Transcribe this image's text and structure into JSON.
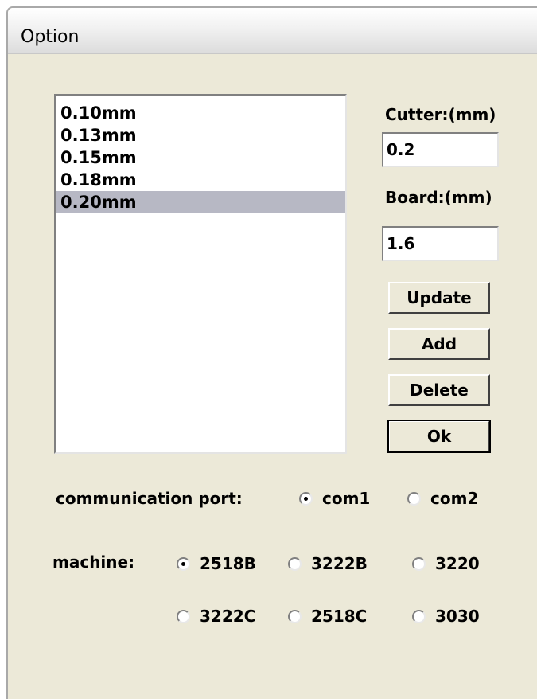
{
  "dialog": {
    "title": "Option"
  },
  "list": {
    "items": [
      "0.10mm",
      "0.13mm",
      "0.15mm",
      "0.18mm",
      "0.20mm"
    ],
    "selected_index": 4
  },
  "cutter": {
    "label": "Cutter:(mm)",
    "value": "0.2"
  },
  "board": {
    "label": "Board:(mm)",
    "value": "1.6"
  },
  "buttons": {
    "update": "Update",
    "add": "Add",
    "delete": "Delete",
    "ok": "Ok"
  },
  "port": {
    "label": "communication port:",
    "options": [
      "com1",
      "com2"
    ],
    "selected": "com1"
  },
  "machine": {
    "label": "machine:",
    "options": [
      "2518B",
      "3222B",
      "3220",
      "3222C",
      "2518C",
      "3030"
    ],
    "selected": "2518B"
  }
}
